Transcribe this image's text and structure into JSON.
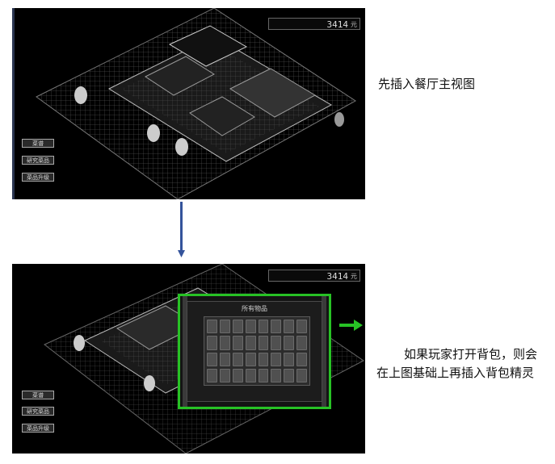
{
  "screen1": {
    "score": "3414",
    "score_unit": "元",
    "menu": [
      "菜谱",
      "研究菜品",
      "菜品升级"
    ]
  },
  "screen2": {
    "score": "3414",
    "score_unit": "元",
    "menu": [
      "菜谱",
      "研究菜品",
      "菜品升级"
    ],
    "bag": {
      "title": "所有物品",
      "slots_cols": 8,
      "slots_rows": 4
    }
  },
  "notes": {
    "note1": "先插入餐厅主视图",
    "note2": "如果玩家打开背包，则会在上图基础上再插入背包精灵"
  },
  "colors": {
    "arrow_down": "#34539b",
    "arrow_right": "#27c225",
    "bag_border": "#27c225"
  }
}
